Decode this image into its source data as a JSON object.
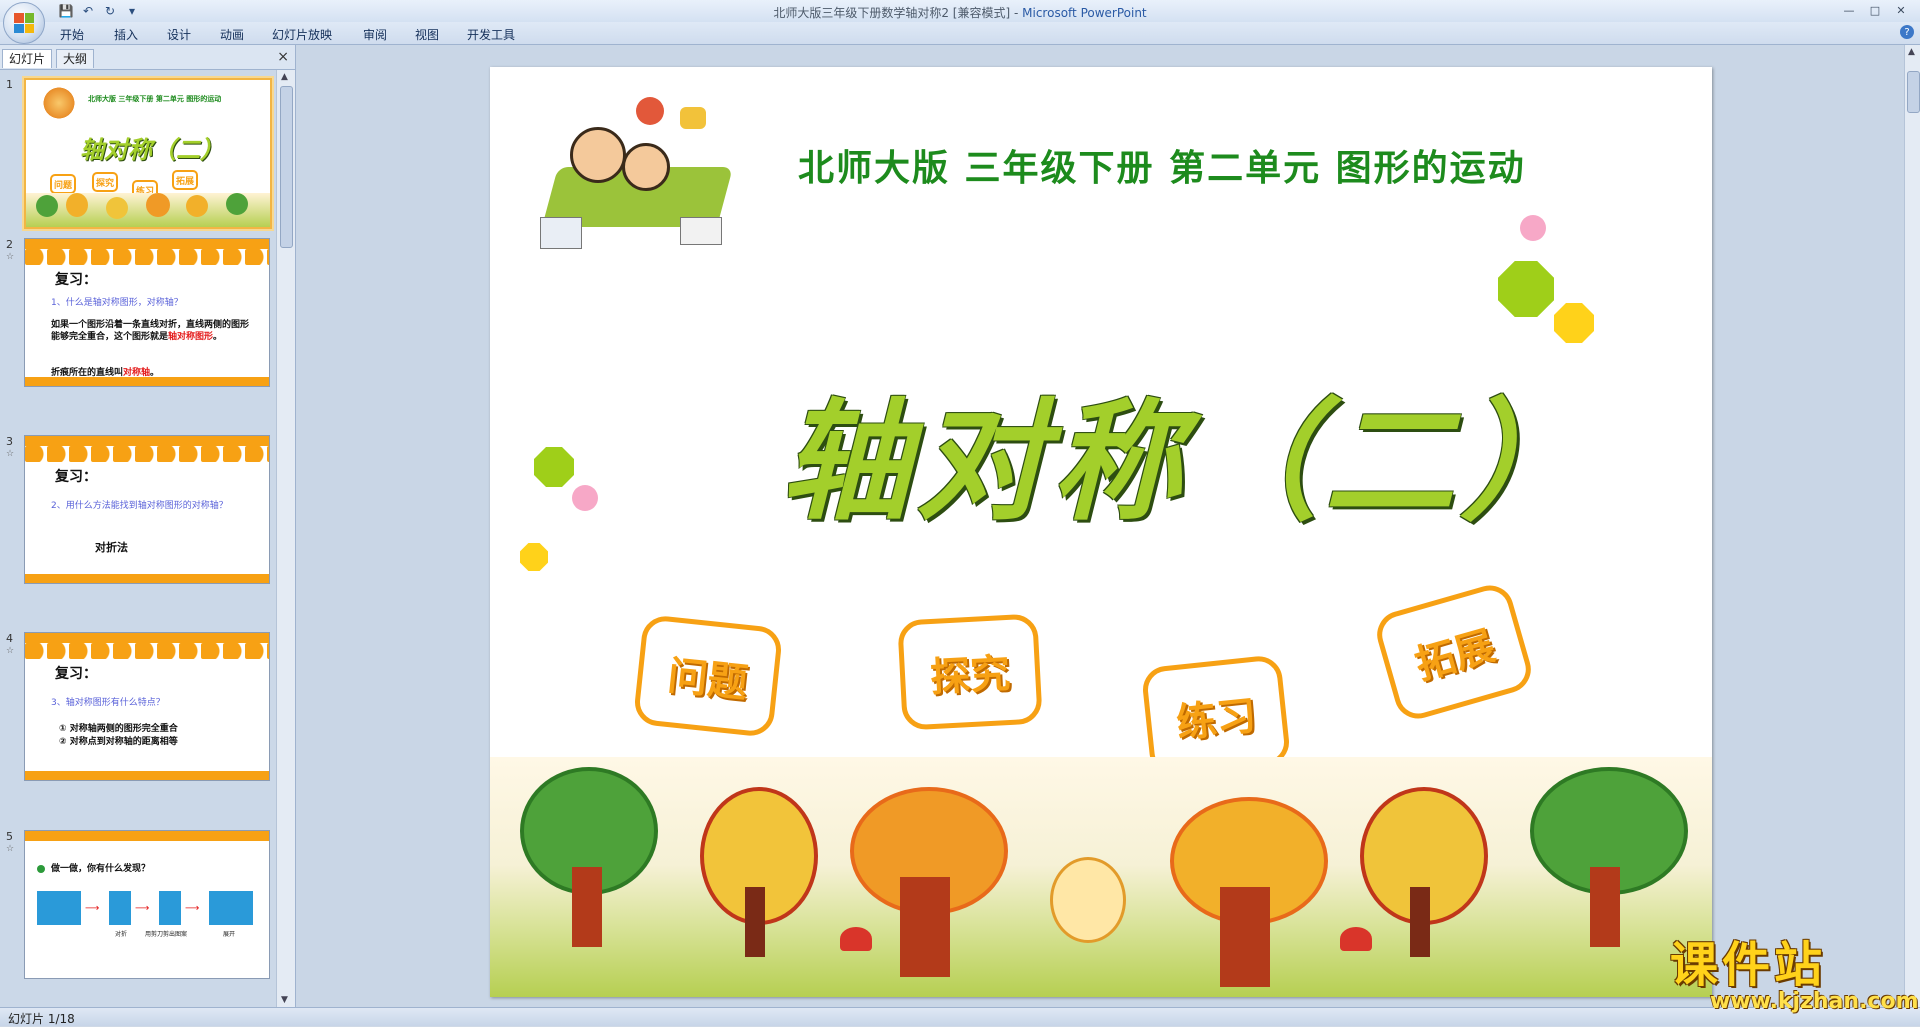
{
  "window": {
    "title_file": "北师大版三年级下册数学轴对称2 [兼容模式]",
    "title_sep": " - ",
    "title_app": "Microsoft PowerPoint"
  },
  "ribbon": {
    "tabs": [
      "开始",
      "插入",
      "设计",
      "动画",
      "幻灯片放映",
      "审阅",
      "视图",
      "开发工具"
    ]
  },
  "pane": {
    "tab_slides": "幻灯片",
    "tab_outline": "大纲",
    "close": "×"
  },
  "thumbnails": [
    {
      "num": "1",
      "subtitle": "北师大版 三年级下册 第二单元 图形的运动",
      "title": "轴对称（二）",
      "badges": [
        "问题",
        "探究",
        "练习",
        "拓展"
      ]
    },
    {
      "num": "2",
      "star": "☆",
      "heading": "复习：",
      "question": "1、什么是轴对称图形，对称轴？",
      "body1": "如果一个图形沿着一条直线对折，直线两侧的图形能够完全重合，这个图形就是",
      "body1_red": "轴对称图形",
      "body1_end": "。",
      "body2": "折痕所在的直线叫",
      "body2_red": "对称轴",
      "body2_end": "。"
    },
    {
      "num": "3",
      "star": "☆",
      "heading": "复习：",
      "question": "2、用什么方法能找到轴对称图形的对称轴？",
      "answer": "对折法"
    },
    {
      "num": "4",
      "star": "☆",
      "heading": "复习：",
      "question": "3、轴对称图形有什么特点？",
      "point1": "① 对称轴两侧的图形完全重合",
      "point2": "② 对称点到对称轴的距离相等"
    },
    {
      "num": "5",
      "star": "☆",
      "heading": "做一做，你有什么发现？",
      "labels": [
        "对折",
        "用剪刀剪出图案",
        "展开"
      ]
    }
  ],
  "slide": {
    "subtitle": "北师大版  三年级下册  第二单元  图形的运动",
    "title": "轴对称（二）",
    "badges": [
      "问题",
      "探究",
      "练习",
      "拓展"
    ]
  },
  "watermark": {
    "cn": "课件站",
    "url": "www.kjzhan.com"
  },
  "status": {
    "slide_counter": "幻灯片 1/18"
  },
  "colors": {
    "accent_orange": "#f7a114",
    "title_green": "#a3cf2b",
    "subtitle_green": "#1d8b1d",
    "question_blue": "#5a62d9",
    "highlight_red": "#e41b1b"
  }
}
